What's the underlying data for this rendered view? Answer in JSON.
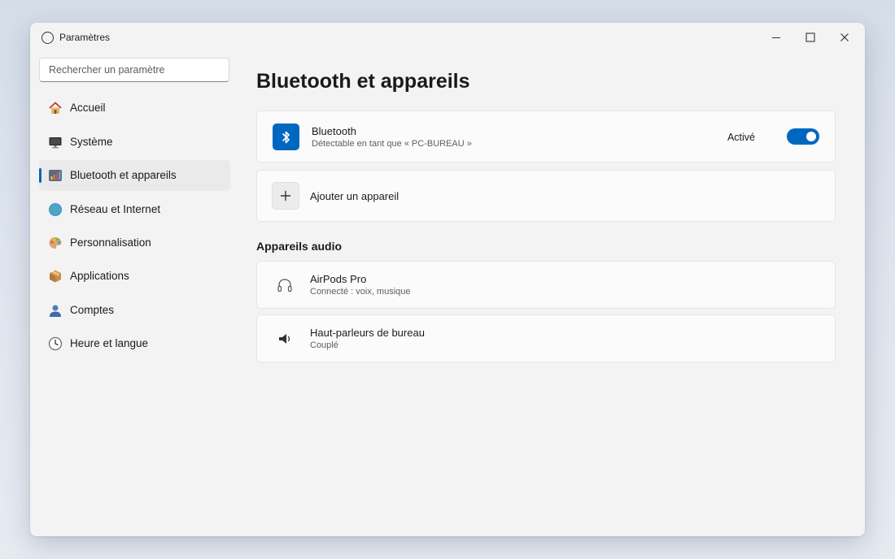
{
  "window": {
    "title": "Paramètres",
    "controls": {
      "minimize_icon": "minimize-icon",
      "maximize_icon": "maximize-icon",
      "close_icon": "close-icon"
    }
  },
  "search": {
    "placeholder": "Rechercher un paramètre",
    "value": ""
  },
  "sidebar": {
    "items": [
      {
        "label": "Accueil",
        "icon": "home-icon",
        "active": false
      },
      {
        "label": "Système",
        "icon": "monitor-icon",
        "active": false
      },
      {
        "label": "Bluetooth et appareils",
        "icon": "bluetooth-devices-icon",
        "active": true
      },
      {
        "label": "Réseau et Internet",
        "icon": "globe-icon",
        "active": false
      },
      {
        "label": "Personnalisation",
        "icon": "palette-icon",
        "active": false
      },
      {
        "label": "Applications",
        "icon": "package-icon",
        "active": false
      },
      {
        "label": "Comptes",
        "icon": "person-icon",
        "active": false
      },
      {
        "label": "Heure et langue",
        "icon": "clock-icon",
        "active": false
      }
    ]
  },
  "main": {
    "title": "Bluetooth et appareils",
    "bluetooth": {
      "title": "Bluetooth",
      "subtitle": "Détectable en tant que « PC-BUREAU »",
      "toggle_label": "Activé",
      "enabled": true,
      "icon": "bluetooth-icon"
    },
    "add_device": {
      "label": "Ajouter un appareil",
      "icon": "plus-icon"
    },
    "audio_section": {
      "title": "Appareils audio",
      "devices": [
        {
          "name": "AirPods Pro",
          "status": "Connecté : voix, musique",
          "icon": "headphones-icon"
        },
        {
          "name": "Haut-parleurs de bureau",
          "status": "Couplé",
          "icon": "speaker-icon"
        }
      ]
    }
  },
  "colors": {
    "accent": "#0067c0",
    "background": "#f3f3f3",
    "card": "#fbfbfb"
  }
}
